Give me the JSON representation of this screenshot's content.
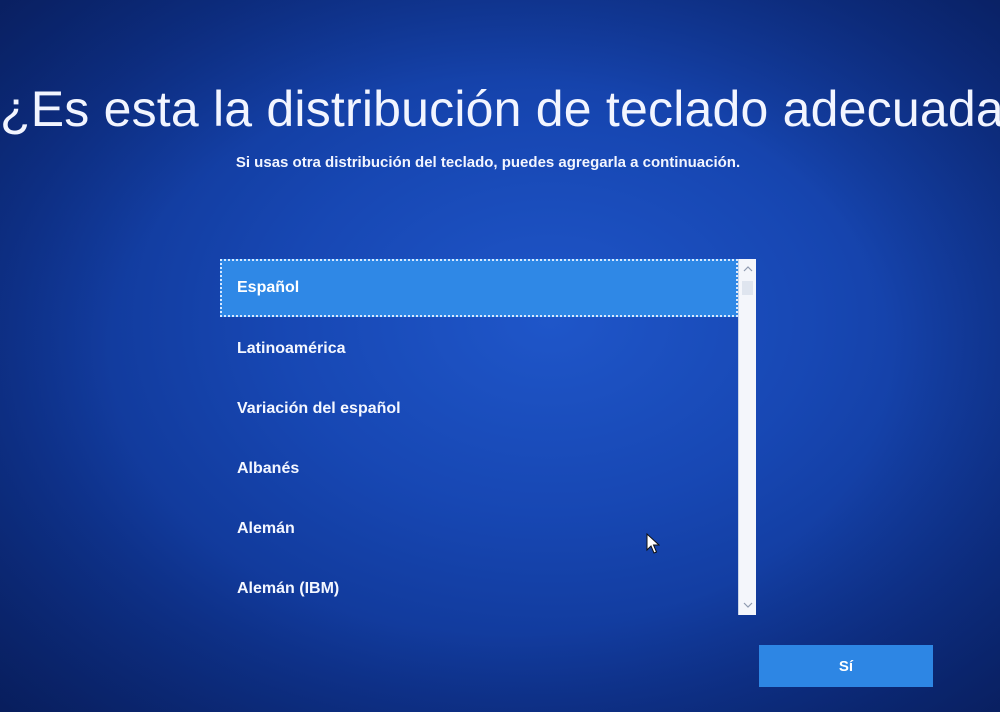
{
  "header": {
    "title": "¿Es esta la distribución de teclado adecuada?",
    "subtitle": "Si usas otra distribución del teclado, puedes agregarla a continuación."
  },
  "layout_list": {
    "selected_index": 0,
    "items": [
      {
        "label": "Español"
      },
      {
        "label": "Latinoamérica"
      },
      {
        "label": "Variación del español"
      },
      {
        "label": "Albanés"
      },
      {
        "label": "Alemán"
      },
      {
        "label": "Alemán (IBM)"
      }
    ],
    "scrollbar": {
      "up_icon": "chevron-up-icon",
      "down_icon": "chevron-down-icon"
    }
  },
  "actions": {
    "yes_label": "Sí"
  },
  "colors": {
    "background": "#1747b3",
    "accent": "#2f88e6",
    "text": "#ffffff"
  }
}
